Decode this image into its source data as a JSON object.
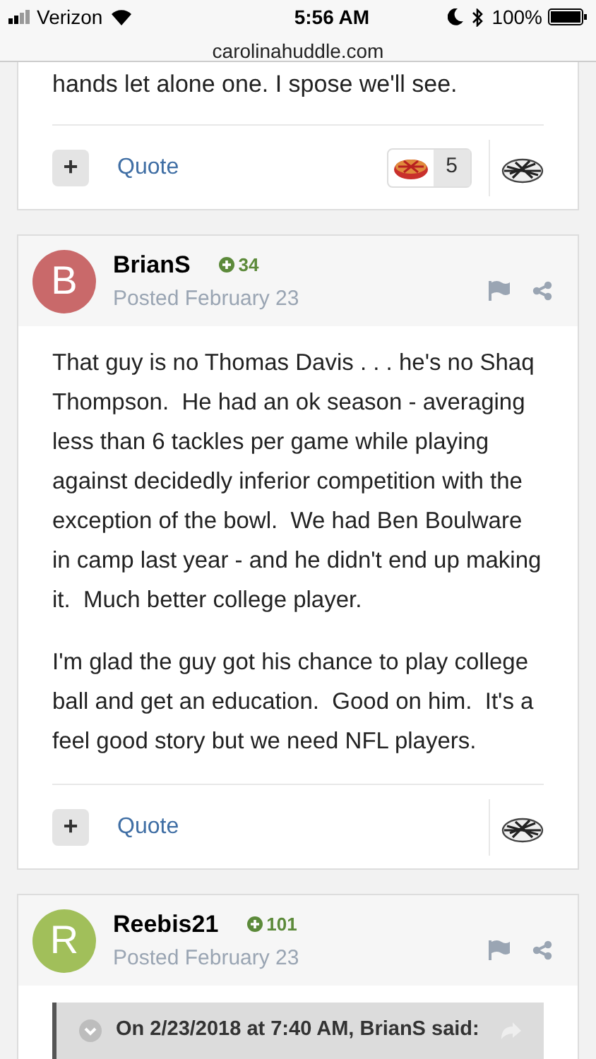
{
  "status_bar": {
    "carrier": "Verizon",
    "time": "5:56 AM",
    "battery": "100%",
    "url": "carolinahuddle.com"
  },
  "posts": [
    {
      "kind": "tail",
      "paragraphs": [
        "hands let alone one. I spose we'll see."
      ],
      "quote_label": "Quote",
      "plus": "+",
      "reaction_count": "5"
    },
    {
      "kind": "full",
      "avatar_letter": "B",
      "color": "#c9696a",
      "author": "BrianS",
      "reputation": "34",
      "posted": "Posted February 23",
      "paragraphs": [
        "That guy is no Thomas Davis . . . he's no Shaq Thompson.  He had an ok season - averaging less than 6 tackles per game while playing against decidedly inferior competition with the exception of the bowl.  We had Ben Boulware in camp last year - and he didn't end up making it.  Much better college player.",
        "I'm glad the guy got his chance to play college ball and get an education.  Good on him.  It's a feel good story but we need NFL players."
      ],
      "quote_label": "Quote",
      "plus": "+"
    },
    {
      "kind": "full",
      "avatar_letter": "R",
      "color": "#a1bf5a",
      "author": "Reebis21",
      "reputation": "101",
      "posted": "Posted February 23",
      "quote_header": "On 2/23/2018 at 7:40 AM, BrianS said:"
    }
  ]
}
